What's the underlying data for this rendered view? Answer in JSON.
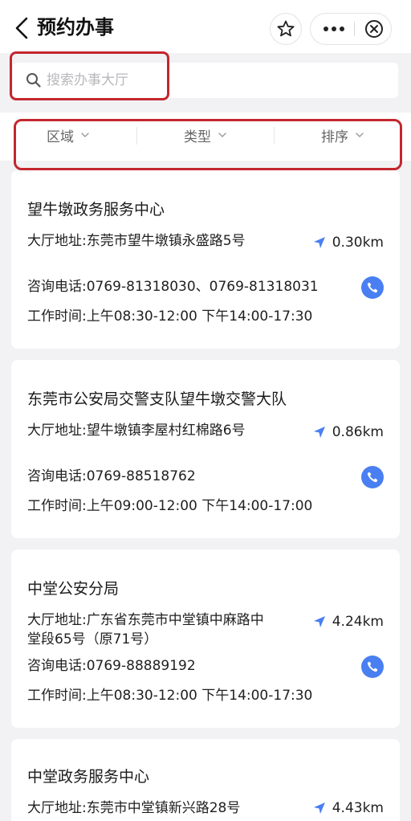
{
  "header": {
    "title": "预约办事",
    "back_icon": "chevron-left-icon",
    "actions": [
      "star-icon",
      "more-icon",
      "close-circle-icon"
    ]
  },
  "search": {
    "placeholder": "搜索办事大厅",
    "value": ""
  },
  "filters": [
    {
      "label": "区域"
    },
    {
      "label": "类型"
    },
    {
      "label": "排序"
    }
  ],
  "annotation_color": "#c4262e",
  "accent_color": "#4a7ff2",
  "halls": [
    {
      "name": "望牛墩政务服务中心",
      "address": "大厅地址:东莞市望牛墩镇永盛路5号",
      "distance": "0.30km",
      "phone": "咨询电话:0769-81318030、0769-81318031",
      "hours": "工作时间:上午08:30-12:00 下午14:00-17:30"
    },
    {
      "name": "东莞市公安局交警支队望牛墩交警大队",
      "address": "大厅地址:望牛墩镇李屋村红棉路6号",
      "distance": "0.86km",
      "phone": "咨询电话:0769-88518762",
      "hours": "工作时间:上午09:00-12:00 下午14:00-17:00"
    },
    {
      "name": "中堂公安分局",
      "address": "大厅地址:广东省东莞市中堂镇中麻路中堂段65号（原71号）",
      "distance": "4.24km",
      "phone": "咨询电话:0769-88889192",
      "hours": "工作时间:上午08:30-12:00 下午14:00-17:30"
    },
    {
      "name": "中堂政务服务中心",
      "address": "大厅地址:东莞市中堂镇新兴路28号",
      "distance": "4.43km"
    }
  ]
}
